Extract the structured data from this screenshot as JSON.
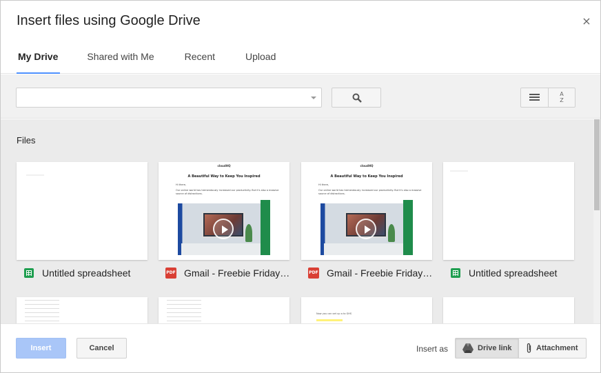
{
  "dialog": {
    "title": "Insert files using Google Drive",
    "close_glyph": "×"
  },
  "tabs": [
    {
      "label": "My Drive",
      "active": true
    },
    {
      "label": "Shared with Me",
      "active": false
    },
    {
      "label": "Recent",
      "active": false
    },
    {
      "label": "Upload",
      "active": false
    }
  ],
  "toolbar": {
    "search_value": "",
    "search_placeholder": "",
    "icons": {
      "search": "search-icon",
      "list_view": "list-view-icon",
      "sort": "sort-az-icon"
    },
    "sort_glyph_top": "A",
    "sort_glyph_bottom": "Z"
  },
  "files": {
    "section_title": "Files",
    "items": [
      {
        "name": "Untitled spreadsheet",
        "type": "spreadsheet"
      },
      {
        "name": "Gmail - Freebie Friday ...",
        "type": "pdf"
      },
      {
        "name": "Gmail - Freebie Friday ...",
        "type": "pdf"
      },
      {
        "name": "Untitled spreadsheet",
        "type": "spreadsheet"
      }
    ],
    "pdf_badge": "PDF",
    "email_preview": {
      "brand": "cloudHQ",
      "headline": "A Beautiful Way to Keep You Inspired",
      "greeting": "Hi there,",
      "body": "Our online world has tremendously increased our productivity. But it's also a massive source of distractions."
    },
    "third_row_snippet": "Now you can set up a to GHS"
  },
  "footer": {
    "insert_label": "Insert",
    "cancel_label": "Cancel",
    "insert_as_label": "Insert as",
    "drive_link_label": "Drive link",
    "attachment_label": "Attachment"
  },
  "colors": {
    "accent": "#4d90fe",
    "insert_disabled": "#a9c6f8",
    "sheets_green": "#1e9e4f",
    "pdf_red": "#d93f34"
  }
}
